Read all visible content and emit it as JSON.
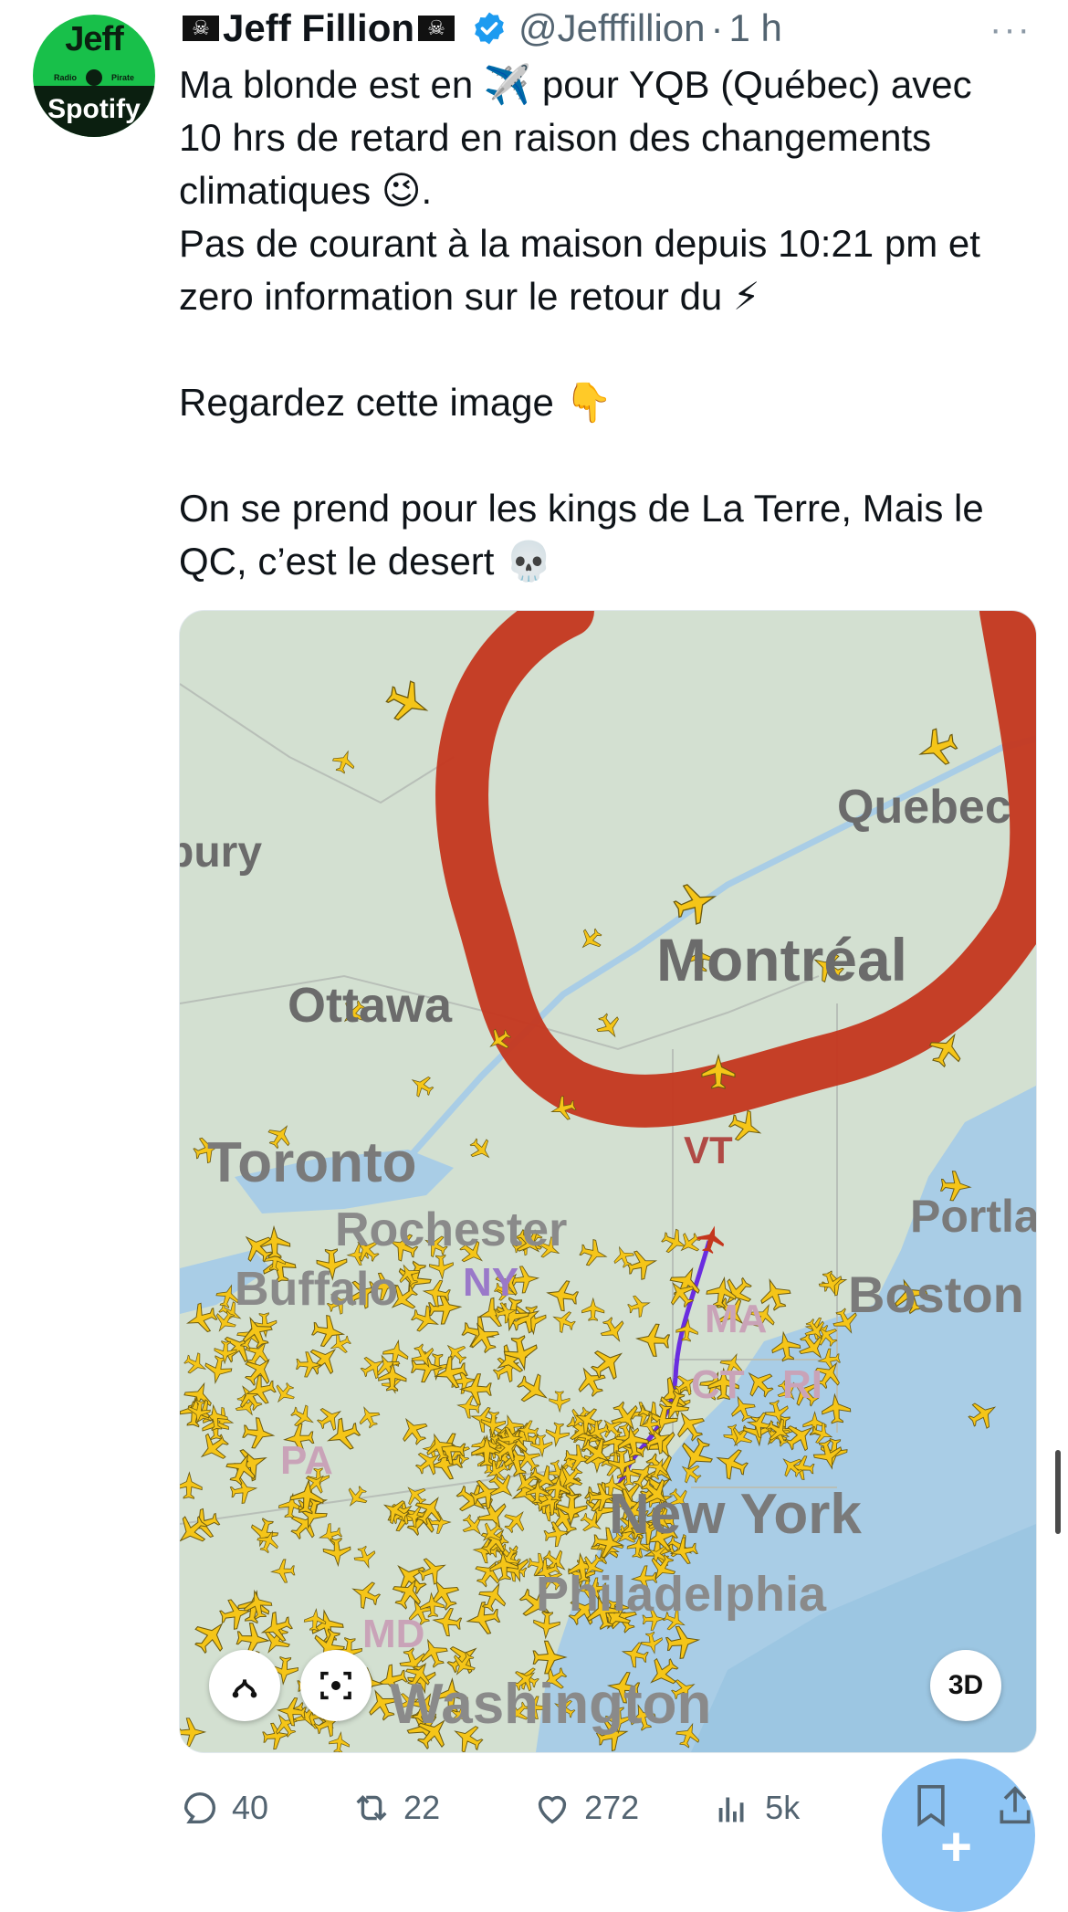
{
  "avatar": {
    "line1": "Jeff",
    "line2_left": "Radio",
    "line2_right": "Pirate",
    "line3": "Spotify"
  },
  "header": {
    "name": "Jeff Fillion",
    "handle": "@Jefffillion",
    "separator": "·",
    "time": "1 h",
    "more": "···"
  },
  "tweet": {
    "text": "Ma blonde est en ✈️ pour YQB (Québec) avec\n10 hrs de retard en raison des changements\nclimatiques 😉.\nPas de courant à la maison depuis 10:21 pm et\nzero information sur le retour du ⚡\n\nRegardez cette image 👇\n\nOn se prend pour les kings de La Terre, Mais le\nQC, c’est le desert 💀"
  },
  "map": {
    "labels": {
      "quebec": "Quebec",
      "bury": "bury",
      "montreal": "Montréal",
      "ottawa": "Ottawa",
      "vt": "VT",
      "toronto": "Toronto",
      "portland": "Portla",
      "rochester": "Rochester",
      "buffalo": "Buffalo",
      "ny": "NY",
      "boston": "Boston",
      "ma": "MA",
      "ct": "CT",
      "ri": "RI",
      "pa": "PA",
      "new_york": "New York",
      "philadelphia": "Philadelphia",
      "md": "MD",
      "washington": "Washington"
    },
    "btn_3d": "3D",
    "colors": {
      "land": "#d3e0d1",
      "water": "#a9cde6",
      "circle": "#c4361d",
      "plane": "#f5c518",
      "route": "#6a2de0"
    }
  },
  "actions": {
    "replies": "40",
    "retweets": "22",
    "likes": "272",
    "views": "5k"
  }
}
